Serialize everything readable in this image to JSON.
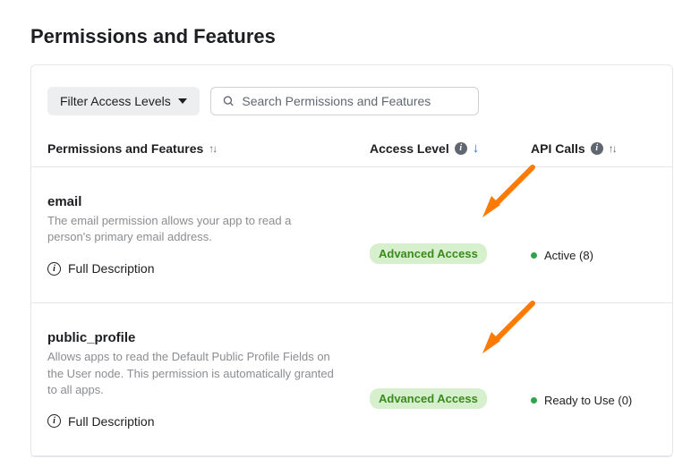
{
  "title": "Permissions and Features",
  "controls": {
    "filter_label": "Filter Access Levels",
    "search_placeholder": "Search Permissions and Features"
  },
  "columns": {
    "name": "Permissions and Features",
    "access": "Access Level",
    "api": "API Calls"
  },
  "full_description_label": "Full Description",
  "rows": [
    {
      "name": "email",
      "desc": "The email permission allows your app to read a person's primary email address.",
      "access_badge": "Advanced Access",
      "api_status": "Active (8)"
    },
    {
      "name": "public_profile",
      "desc": "Allows apps to read the Default Public Profile Fields on the User node. This permission is automatically granted to all apps.",
      "access_badge": "Advanced Access",
      "api_status": "Ready to Use (0)"
    }
  ]
}
